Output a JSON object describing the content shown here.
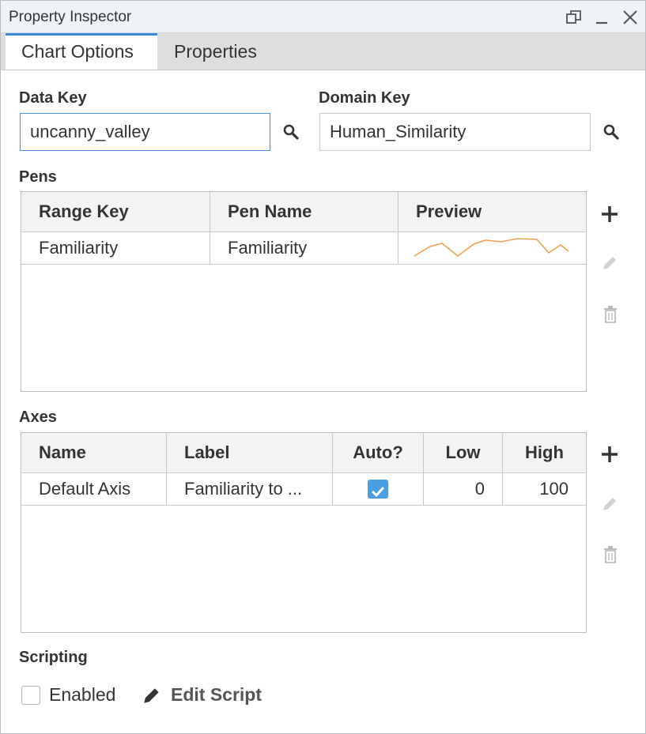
{
  "window": {
    "title": "Property Inspector"
  },
  "tabs": [
    {
      "label": "Chart Options"
    },
    {
      "label": "Properties"
    }
  ],
  "data_key": {
    "label": "Data Key",
    "value": "uncanny_valley"
  },
  "domain_key": {
    "label": "Domain Key",
    "value": "Human_Similarity"
  },
  "pens": {
    "label": "Pens",
    "columns": [
      "Range Key",
      "Pen Name",
      "Preview"
    ],
    "rows": [
      {
        "range_key": "Familiarity",
        "pen_name": "Familiarity"
      }
    ],
    "preview_color": "#f0a050"
  },
  "axes": {
    "label": "Axes",
    "columns": [
      "Name",
      "Label",
      "Auto?",
      "Low",
      "High"
    ],
    "rows": [
      {
        "name": "Default Axis",
        "label": "Familiarity to ...",
        "auto": true,
        "low": "0",
        "high": "100"
      }
    ]
  },
  "scripting": {
    "label": "Scripting",
    "enabled_label": "Enabled",
    "enabled": false,
    "edit_label": "Edit Script"
  },
  "colors": {
    "accent": "#3a8bd4",
    "checkbox": "#4a9fe0"
  }
}
